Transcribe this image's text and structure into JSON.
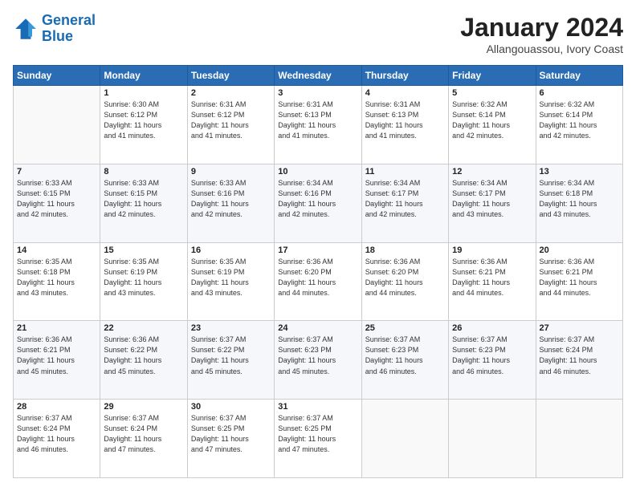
{
  "logo": {
    "line1": "General",
    "line2": "Blue"
  },
  "header": {
    "month": "January 2024",
    "location": "Allangouassou, Ivory Coast"
  },
  "weekdays": [
    "Sunday",
    "Monday",
    "Tuesday",
    "Wednesday",
    "Thursday",
    "Friday",
    "Saturday"
  ],
  "weeks": [
    [
      {
        "day": "",
        "info": ""
      },
      {
        "day": "1",
        "info": "Sunrise: 6:30 AM\nSunset: 6:12 PM\nDaylight: 11 hours\nand 41 minutes."
      },
      {
        "day": "2",
        "info": "Sunrise: 6:31 AM\nSunset: 6:12 PM\nDaylight: 11 hours\nand 41 minutes."
      },
      {
        "day": "3",
        "info": "Sunrise: 6:31 AM\nSunset: 6:13 PM\nDaylight: 11 hours\nand 41 minutes."
      },
      {
        "day": "4",
        "info": "Sunrise: 6:31 AM\nSunset: 6:13 PM\nDaylight: 11 hours\nand 41 minutes."
      },
      {
        "day": "5",
        "info": "Sunrise: 6:32 AM\nSunset: 6:14 PM\nDaylight: 11 hours\nand 42 minutes."
      },
      {
        "day": "6",
        "info": "Sunrise: 6:32 AM\nSunset: 6:14 PM\nDaylight: 11 hours\nand 42 minutes."
      }
    ],
    [
      {
        "day": "7",
        "info": "Sunrise: 6:33 AM\nSunset: 6:15 PM\nDaylight: 11 hours\nand 42 minutes."
      },
      {
        "day": "8",
        "info": "Sunrise: 6:33 AM\nSunset: 6:15 PM\nDaylight: 11 hours\nand 42 minutes."
      },
      {
        "day": "9",
        "info": "Sunrise: 6:33 AM\nSunset: 6:16 PM\nDaylight: 11 hours\nand 42 minutes."
      },
      {
        "day": "10",
        "info": "Sunrise: 6:34 AM\nSunset: 6:16 PM\nDaylight: 11 hours\nand 42 minutes."
      },
      {
        "day": "11",
        "info": "Sunrise: 6:34 AM\nSunset: 6:17 PM\nDaylight: 11 hours\nand 42 minutes."
      },
      {
        "day": "12",
        "info": "Sunrise: 6:34 AM\nSunset: 6:17 PM\nDaylight: 11 hours\nand 43 minutes."
      },
      {
        "day": "13",
        "info": "Sunrise: 6:34 AM\nSunset: 6:18 PM\nDaylight: 11 hours\nand 43 minutes."
      }
    ],
    [
      {
        "day": "14",
        "info": "Sunrise: 6:35 AM\nSunset: 6:18 PM\nDaylight: 11 hours\nand 43 minutes."
      },
      {
        "day": "15",
        "info": "Sunrise: 6:35 AM\nSunset: 6:19 PM\nDaylight: 11 hours\nand 43 minutes."
      },
      {
        "day": "16",
        "info": "Sunrise: 6:35 AM\nSunset: 6:19 PM\nDaylight: 11 hours\nand 43 minutes."
      },
      {
        "day": "17",
        "info": "Sunrise: 6:36 AM\nSunset: 6:20 PM\nDaylight: 11 hours\nand 44 minutes."
      },
      {
        "day": "18",
        "info": "Sunrise: 6:36 AM\nSunset: 6:20 PM\nDaylight: 11 hours\nand 44 minutes."
      },
      {
        "day": "19",
        "info": "Sunrise: 6:36 AM\nSunset: 6:21 PM\nDaylight: 11 hours\nand 44 minutes."
      },
      {
        "day": "20",
        "info": "Sunrise: 6:36 AM\nSunset: 6:21 PM\nDaylight: 11 hours\nand 44 minutes."
      }
    ],
    [
      {
        "day": "21",
        "info": "Sunrise: 6:36 AM\nSunset: 6:21 PM\nDaylight: 11 hours\nand 45 minutes."
      },
      {
        "day": "22",
        "info": "Sunrise: 6:36 AM\nSunset: 6:22 PM\nDaylight: 11 hours\nand 45 minutes."
      },
      {
        "day": "23",
        "info": "Sunrise: 6:37 AM\nSunset: 6:22 PM\nDaylight: 11 hours\nand 45 minutes."
      },
      {
        "day": "24",
        "info": "Sunrise: 6:37 AM\nSunset: 6:23 PM\nDaylight: 11 hours\nand 45 minutes."
      },
      {
        "day": "25",
        "info": "Sunrise: 6:37 AM\nSunset: 6:23 PM\nDaylight: 11 hours\nand 46 minutes."
      },
      {
        "day": "26",
        "info": "Sunrise: 6:37 AM\nSunset: 6:23 PM\nDaylight: 11 hours\nand 46 minutes."
      },
      {
        "day": "27",
        "info": "Sunrise: 6:37 AM\nSunset: 6:24 PM\nDaylight: 11 hours\nand 46 minutes."
      }
    ],
    [
      {
        "day": "28",
        "info": "Sunrise: 6:37 AM\nSunset: 6:24 PM\nDaylight: 11 hours\nand 46 minutes."
      },
      {
        "day": "29",
        "info": "Sunrise: 6:37 AM\nSunset: 6:24 PM\nDaylight: 11 hours\nand 47 minutes."
      },
      {
        "day": "30",
        "info": "Sunrise: 6:37 AM\nSunset: 6:25 PM\nDaylight: 11 hours\nand 47 minutes."
      },
      {
        "day": "31",
        "info": "Sunrise: 6:37 AM\nSunset: 6:25 PM\nDaylight: 11 hours\nand 47 minutes."
      },
      {
        "day": "",
        "info": ""
      },
      {
        "day": "",
        "info": ""
      },
      {
        "day": "",
        "info": ""
      }
    ]
  ]
}
